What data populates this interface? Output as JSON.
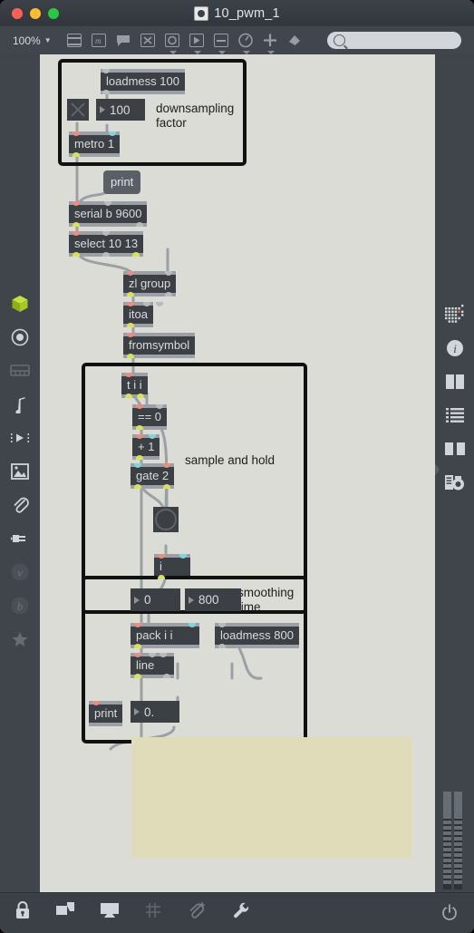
{
  "window": {
    "title": "10_pwm_1",
    "traffic_lights": [
      "close",
      "minimize",
      "zoom"
    ]
  },
  "toolbar": {
    "zoom_level": "100%",
    "zoom_caret": "▼",
    "icons": [
      "patcher-windows-icon",
      "comment-icon",
      "message-icon",
      "toggle-icon",
      "button-icon",
      "playbar-icon",
      "slider-icon",
      "gauge-icon",
      "add-object-icon",
      "paint-fill-icon"
    ],
    "search": {
      "placeholder": "",
      "value": "",
      "icon": "search-icon"
    }
  },
  "left_dock": {
    "items": [
      "package-icon",
      "circle-target-icon",
      "keyboard-icon",
      "music-note-icon",
      "video-icon",
      "image-icon",
      "paperclip-icon",
      "plug-icon",
      "letter-v-icon",
      "letter-b-icon",
      "star-icon"
    ]
  },
  "right_dock": {
    "items": [
      "grid-matrix-icon",
      "info-icon",
      "columns-icon",
      "list-icon",
      "book-icon",
      "snapshot-icon"
    ],
    "edge_handle": "collapse-arrow-icon",
    "meter": "level-meter"
  },
  "bottom_bar": {
    "icons": [
      "lock-icon",
      "copy-windows-icon",
      "presentation-icon",
      "grid-icon",
      "add-clipping-icon",
      "wrench-icon"
    ],
    "right_icon": "power-icon"
  },
  "patcher": {
    "regions": [
      {
        "name": "downsampling-region"
      },
      {
        "name": "sample-and-hold-region"
      },
      {
        "name": "smoothing-time-region"
      }
    ],
    "comments": [
      {
        "id": "downsampling",
        "text": "downsampling\nfactor"
      },
      {
        "id": "sample_hold",
        "text": "sample and hold"
      },
      {
        "id": "smoothing",
        "text": "smoothing\ntime"
      }
    ],
    "objects": [
      {
        "id": "loadmess100",
        "text": "loadmess 100"
      },
      {
        "id": "toggle",
        "text": ""
      },
      {
        "id": "num100",
        "text": "100"
      },
      {
        "id": "metro1",
        "text": "metro 1"
      },
      {
        "id": "print1",
        "text": "print"
      },
      {
        "id": "serial",
        "text": "serial b 9600"
      },
      {
        "id": "select",
        "text": "select 10 13"
      },
      {
        "id": "zlgroup",
        "text": "zl group"
      },
      {
        "id": "itoa",
        "text": "itoa"
      },
      {
        "id": "fromsymbol",
        "text": "fromsymbol"
      },
      {
        "id": "tii",
        "text": "t i i"
      },
      {
        "id": "eq0",
        "text": "== 0"
      },
      {
        "id": "plus1",
        "text": "+ 1"
      },
      {
        "id": "gate2",
        "text": "gate 2"
      },
      {
        "id": "bang",
        "text": ""
      },
      {
        "id": "iobj",
        "text": "i"
      },
      {
        "id": "num0",
        "text": "0"
      },
      {
        "id": "num800",
        "text": "800"
      },
      {
        "id": "loadmess800",
        "text": "loadmess 800"
      },
      {
        "id": "packii",
        "text": "pack i i"
      },
      {
        "id": "line",
        "text": "line"
      },
      {
        "id": "print2",
        "text": "print"
      },
      {
        "id": "num0dot",
        "text": "0."
      }
    ],
    "panel_color": "#e0dcba",
    "canvas_color": "#dcdcd7"
  }
}
